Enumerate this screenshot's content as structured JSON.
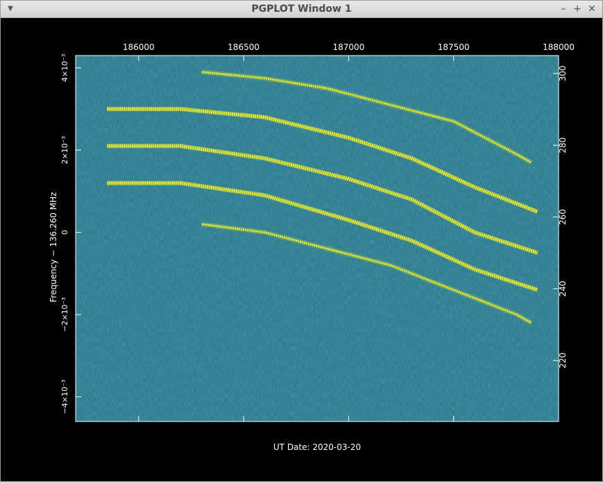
{
  "window": {
    "title": "PGPLOT Window 1",
    "menu_icon": "chevron-down-icon",
    "minimize_symbol": "–",
    "maximize_symbol": "+",
    "close_symbol": "✕"
  },
  "colors": {
    "background": "#000000",
    "plot_base": "#2f7d8f",
    "trace": "#ffee22",
    "trace_mid": "#9bd24a",
    "axis": "#ffffff"
  },
  "chart_data": {
    "type": "heatmap",
    "xlabel": "UT Date: 2020-03-20",
    "ylabel": "Frequency − 136.260 MHz",
    "y2label": "",
    "xlim": [
      185700,
      188000
    ],
    "ylim": [
      -0.0046,
      0.0043
    ],
    "y2lim": [
      203,
      305
    ],
    "x_ticks": [
      {
        "value": 186000,
        "label": "186000"
      },
      {
        "value": 186500,
        "label": "186500"
      },
      {
        "value": 187000,
        "label": "187000"
      },
      {
        "value": 187500,
        "label": "187500"
      },
      {
        "value": 188000,
        "label": "188000"
      }
    ],
    "y_ticks": [
      {
        "value": -0.004,
        "label": "−4×10⁻³"
      },
      {
        "value": -0.002,
        "label": "−2×10⁻³"
      },
      {
        "value": 0,
        "label": "0"
      },
      {
        "value": 0.002,
        "label": "2×10⁻³"
      },
      {
        "value": 0.004,
        "label": "4×10⁻³"
      }
    ],
    "y2_ticks": [
      {
        "value": 220,
        "label": "220"
      },
      {
        "value": 240,
        "label": "240"
      },
      {
        "value": 260,
        "label": "260"
      },
      {
        "value": 280,
        "label": "280"
      },
      {
        "value": 300,
        "label": "300"
      }
    ],
    "series": [
      {
        "points": [
          [
            186300,
            0.0039
          ],
          [
            186600,
            0.00375
          ],
          [
            186900,
            0.0035
          ],
          [
            187200,
            0.0031
          ],
          [
            187500,
            0.0027
          ],
          [
            187800,
            0.0019
          ],
          [
            187870,
            0.0017
          ]
        ]
      },
      {
        "points": [
          [
            185850,
            0.003
          ],
          [
            186200,
            0.003
          ],
          [
            186600,
            0.0028
          ],
          [
            187000,
            0.0023
          ],
          [
            187300,
            0.0018
          ],
          [
            187600,
            0.0011
          ],
          [
            187900,
            0.0005
          ]
        ]
      },
      {
        "points": [
          [
            185850,
            0.0021
          ],
          [
            186200,
            0.0021
          ],
          [
            186600,
            0.0018
          ],
          [
            187000,
            0.0013
          ],
          [
            187300,
            0.0008
          ],
          [
            187600,
            0.0
          ],
          [
            187900,
            -0.0005
          ]
        ]
      },
      {
        "points": [
          [
            185850,
            0.0012
          ],
          [
            186200,
            0.0012
          ],
          [
            186600,
            0.0009
          ],
          [
            187000,
            0.0003
          ],
          [
            187300,
            -0.0002
          ],
          [
            187600,
            -0.0009
          ],
          [
            187900,
            -0.0014
          ]
        ]
      },
      {
        "points": [
          [
            186300,
            0.0002
          ],
          [
            186600,
            0.0
          ],
          [
            186900,
            -0.0004
          ],
          [
            187200,
            -0.0008
          ],
          [
            187500,
            -0.0014
          ],
          [
            187800,
            -0.002
          ],
          [
            187870,
            -0.0022
          ]
        ]
      }
    ]
  }
}
